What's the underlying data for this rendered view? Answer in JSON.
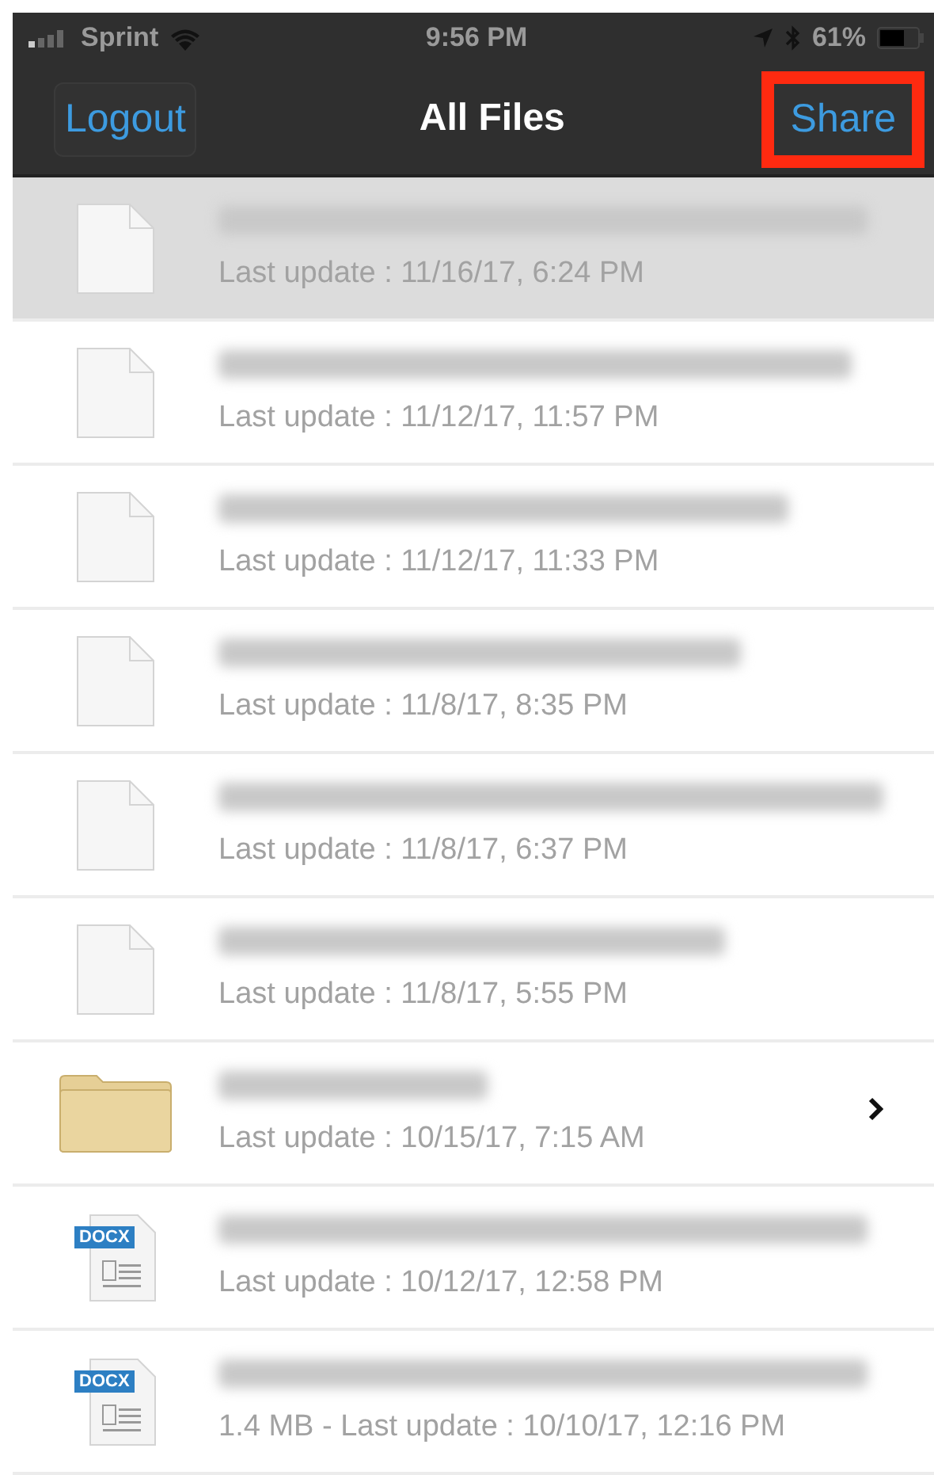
{
  "status_bar": {
    "carrier": "Sprint",
    "time": "9:56 PM",
    "battery": "61%"
  },
  "nav": {
    "left_button": "Logout",
    "title": "All Files",
    "right_button": "Share",
    "right_highlighted": true
  },
  "files": [
    {
      "kind": "file",
      "subtitle": "Last update : 11/16/17, 6:24 PM",
      "selected": true
    },
    {
      "kind": "file",
      "subtitle": "Last update : 11/12/17, 11:57 PM",
      "selected": false
    },
    {
      "kind": "file",
      "subtitle": "Last update : 11/12/17, 11:33 PM",
      "selected": false
    },
    {
      "kind": "file",
      "subtitle": "Last update : 11/8/17, 8:35 PM",
      "selected": false
    },
    {
      "kind": "file",
      "subtitle": "Last update : 11/8/17, 6:37 PM",
      "selected": false
    },
    {
      "kind": "file",
      "subtitle": "Last update : 11/8/17, 5:55 PM",
      "selected": false
    },
    {
      "kind": "folder",
      "subtitle": "Last update : 10/15/17, 7:15 AM",
      "selected": false
    },
    {
      "kind": "docx",
      "badge": "DOCX",
      "subtitle": "Last update : 10/12/17, 12:58 PM",
      "selected": false
    },
    {
      "kind": "docx",
      "badge": "DOCX",
      "subtitle": "1.4 MB - Last update : 10/10/17, 12:16 PM",
      "selected": false
    }
  ]
}
